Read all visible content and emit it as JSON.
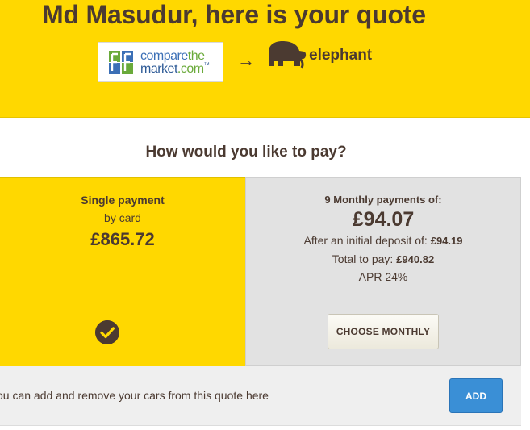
{
  "header": {
    "title": "Md Masudur, here is your quote",
    "partner_logo": {
      "line1_a": "compare",
      "line1_b": "the",
      "line2_a": "market",
      "line2_b": ".com",
      "tm": "™"
    },
    "arrow": "→",
    "brand_name": "elephant"
  },
  "question": "How would you like to pay?",
  "options": {
    "single": {
      "label": "Single payment",
      "sub": "by card",
      "price": "£865.72",
      "selected": true
    },
    "monthly": {
      "label": "9 Monthly payments of:",
      "price": "£94.07",
      "deposit_label": "After an initial deposit of:",
      "deposit_value": "£94.19",
      "total_label": "Total to pay:",
      "total_value": "£940.82",
      "apr": "APR 24%",
      "button": "CHOOSE MONTHLY"
    }
  },
  "cars": {
    "text": "ou can add and remove your cars from this quote here",
    "button": "ADD"
  },
  "colors": {
    "brand_yellow": "#ffd800",
    "brand_brown": "#4b3a31",
    "add_blue": "#3a8fd6",
    "panel_grey": "#e2e2e2"
  }
}
